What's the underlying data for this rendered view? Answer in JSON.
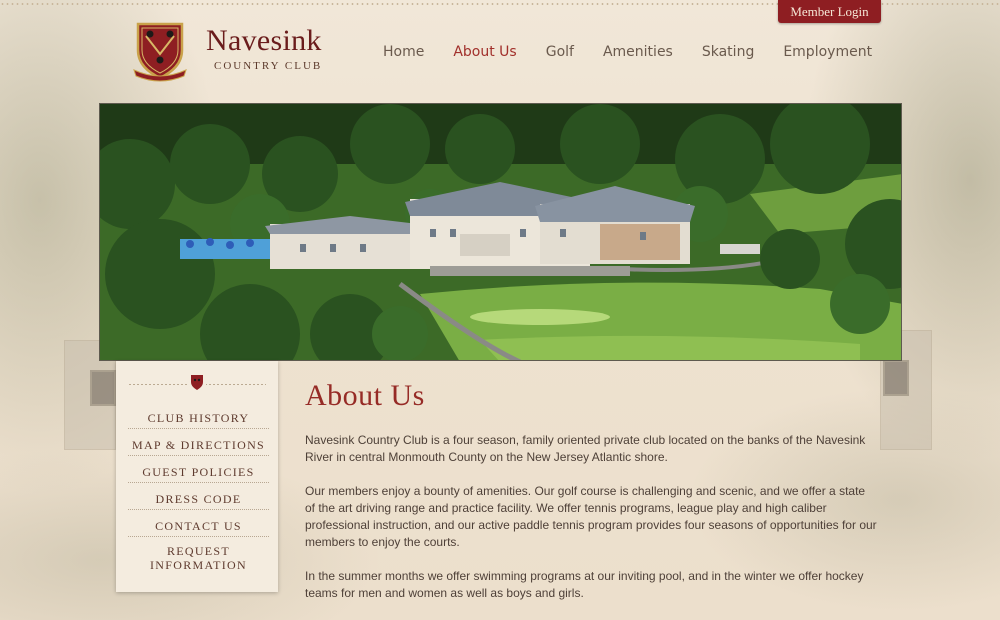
{
  "header": {
    "member_login": "Member Login",
    "logo_name": "Navesink",
    "logo_sub": "COUNTRY CLUB"
  },
  "nav": {
    "items": [
      {
        "label": "Home",
        "active": false
      },
      {
        "label": "About Us",
        "active": true
      },
      {
        "label": "Golf",
        "active": false
      },
      {
        "label": "Amenities",
        "active": false
      },
      {
        "label": "Skating",
        "active": false
      },
      {
        "label": "Employment",
        "active": false
      }
    ]
  },
  "sidebar": {
    "items": [
      {
        "label": "CLUB HISTORY"
      },
      {
        "label": "MAP & DIRECTIONS"
      },
      {
        "label": "GUEST POLICIES"
      },
      {
        "label": "DRESS CODE"
      },
      {
        "label": "CONTACT US"
      },
      {
        "label": "REQUEST\nINFORMATION"
      }
    ]
  },
  "main": {
    "title": "About Us",
    "paragraphs": [
      "Navesink Country Club is a four season, family oriented private club located on the banks of the Navesink River in central Monmouth County on the New Jersey Atlantic shore.",
      "Our members enjoy a bounty of amenities. Our golf course is challenging and scenic, and we offer a state of the art driving range and practice facility. We offer tennis programs, league play and high caliber professional instruction, and our active paddle tennis program provides four seasons of opportunities for our members to enjoy the courts.",
      "In the summer months we offer swimming programs at our inviting pool, and in the winter we offer hockey teams for men and women as well as boys and girls."
    ]
  },
  "colors": {
    "brand_red": "#8e1e22",
    "nav_active": "#a1302b",
    "title_red": "#962b26"
  }
}
